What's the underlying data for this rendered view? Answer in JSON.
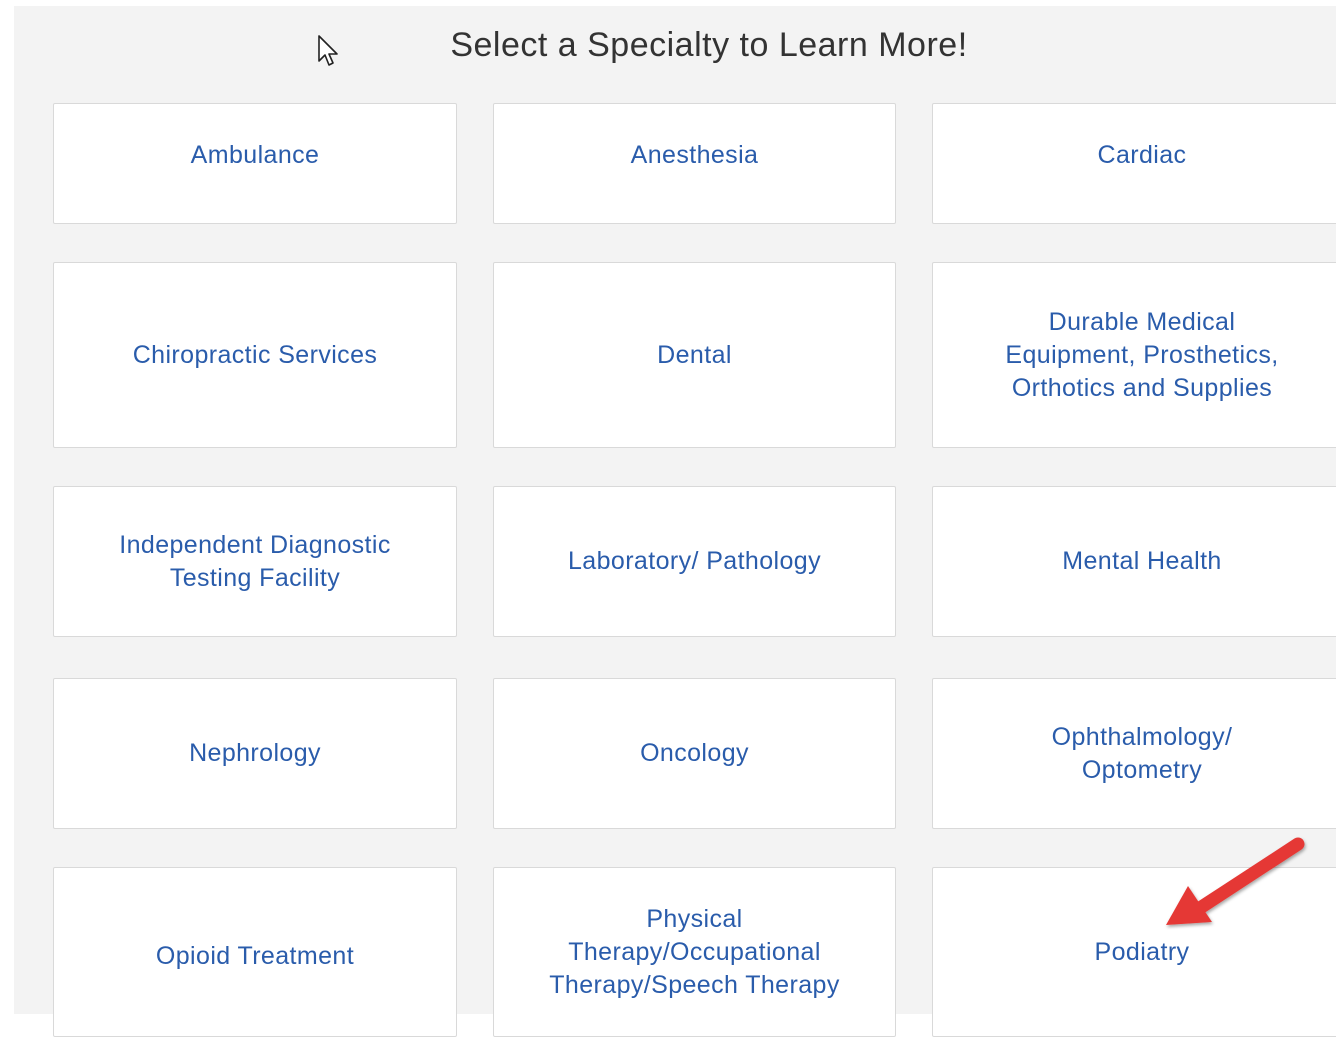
{
  "page": {
    "heading": "Select a Specialty to Learn More!"
  },
  "specialties": [
    "Ambulance",
    "Anesthesia",
    "Cardiac",
    "Chiropractic Services",
    "Dental",
    "Durable Medical\nEquipment, Prosthetics,\nOrthotics and Supplies",
    "Independent Diagnostic\nTesting Facility",
    "Laboratory/ Pathology",
    "Mental Health",
    "Nephrology",
    "Oncology",
    "Ophthalmology/\nOptometry",
    "Opioid Treatment",
    "Physical\nTherapy/Occupational\nTherapy/Speech Therapy",
    "Podiatry"
  ],
  "colors": {
    "panel_background": "#f3f3f3",
    "card_background": "#ffffff",
    "card_border": "#d9d9d9",
    "link_text": "#2a5cab",
    "heading_text": "#333333",
    "annotation_arrow": "#e53935"
  },
  "icons": {
    "cursor": "mouse-pointer-icon",
    "annotation": "red-arrow-icon"
  }
}
